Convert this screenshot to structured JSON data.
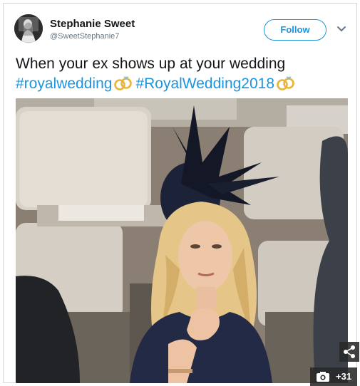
{
  "tweet": {
    "user_name": "Stephanie Sweet",
    "user_handle": "@SweetStephanie7",
    "follow_label": "Follow",
    "text": "When your ex shows up at your wedding",
    "hashtags": [
      "#royalwedding",
      "#RoyalWedding2018"
    ],
    "hashtag_emoji": "rings-emoji-icon"
  },
  "media": {
    "description_icon": "photo",
    "gallery_count": "+31"
  },
  "colors": {
    "accent": "#1b95e0",
    "text": "#14171a",
    "muted": "#657786",
    "border": "#d3d7da"
  }
}
